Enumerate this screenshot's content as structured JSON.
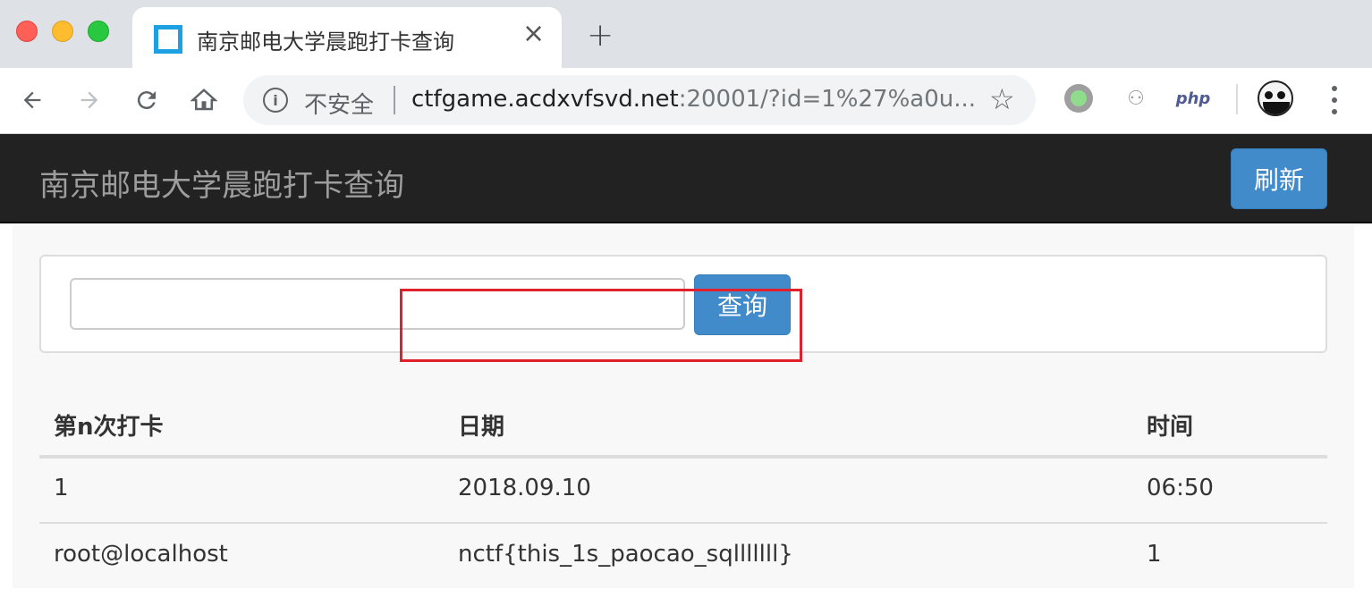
{
  "browser": {
    "tab_title": "南京邮电大学晨跑打卡查询",
    "tab_close_glyph": "×",
    "new_tab_glyph": "+",
    "security_label": "不安全",
    "url_host": "ctfgame.acdxvfsvd.net",
    "url_rest": ":20001/?id=1%27%a0u...",
    "extension_php_label": "php"
  },
  "navbar": {
    "brand": "南京邮电大学晨跑打卡查询",
    "refresh_label": "刷新"
  },
  "search": {
    "value": "",
    "placeholder": "",
    "button_label": "查询"
  },
  "table": {
    "headers": [
      "第n次打卡",
      "日期",
      "时间"
    ],
    "rows": [
      [
        "1",
        "2018.09.10",
        "06:50"
      ],
      [
        "root@localhost",
        "nctf{this_1s_paocao_sqlllllll}",
        "1"
      ]
    ]
  },
  "colors": {
    "navbar_bg": "#222222",
    "primary_button": "#428bca",
    "highlight_border": "#e0202a"
  }
}
